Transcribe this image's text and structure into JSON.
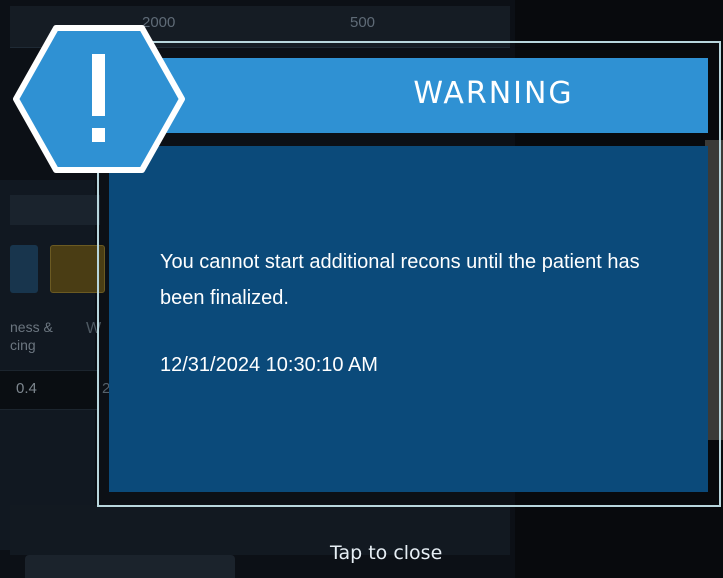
{
  "background": {
    "top_values": [
      "2000",
      "500"
    ],
    "side_label": "ness & cing",
    "side_label_2": "W",
    "row_value_1": "0.4",
    "row_value_2": "2"
  },
  "dialog": {
    "title": "WARNING",
    "message": "You cannot start additional recons until the patient has been finalized.",
    "timestamp": "12/31/2024 10:30:10 AM",
    "icon": "warning-exclamation-hexagon-icon",
    "colors": {
      "header": "#2f91d3",
      "body": "#0b4a7a",
      "frame": "#b8d6dd"
    }
  },
  "footer": {
    "tap_to_close": "Tap to close"
  }
}
